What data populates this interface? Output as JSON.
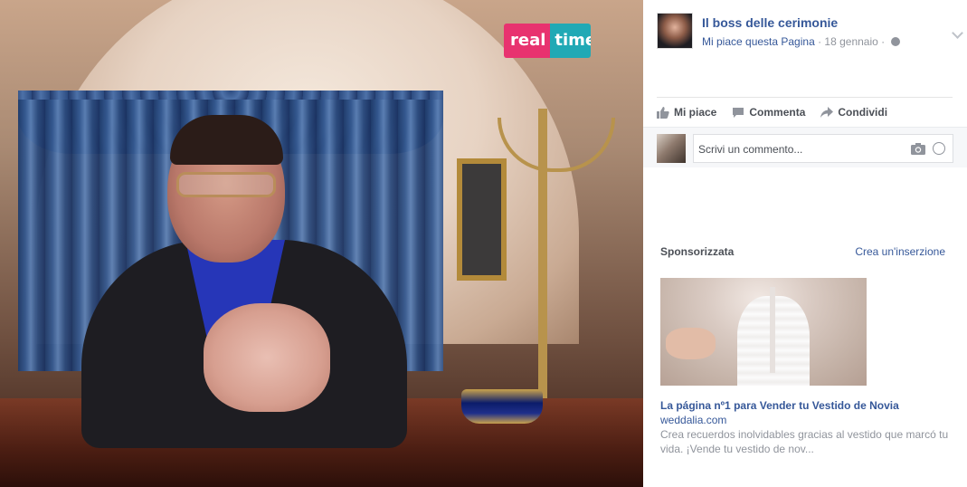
{
  "media": {
    "logo_text_1": "real",
    "logo_text_2": "time",
    "logo_colors": [
      "#e8326f",
      "#20a9b5"
    ]
  },
  "post": {
    "page_name": "Il boss delle cerimonie",
    "like_page": "Mi piace questa Pagina",
    "separator": " · ",
    "date": "18 gennaio",
    "privacy_icon": "globe-icon",
    "menu_icon": "chevron-down-icon"
  },
  "actions": [
    {
      "label": "Mi piace",
      "icon": "thumbs-up-icon"
    },
    {
      "label": "Commenta",
      "icon": "comment-icon"
    },
    {
      "label": "Condividi",
      "icon": "share-icon"
    }
  ],
  "comment": {
    "placeholder": "Scrivi un commento...",
    "icons": [
      "camera-icon",
      "smiley-icon"
    ]
  },
  "sponsored": {
    "title": "Sponsorizzata",
    "create_ad": "Crea un'inserzione",
    "ad": {
      "title": "La página nº1 para Vender tu Vestido de Novia",
      "domain": "weddalia.com",
      "body": "Crea recuerdos inolvidables gracias al vestido que marcó tu vida. ¡Vende tu vestido de nov..."
    }
  },
  "colors": {
    "link": "#365899",
    "muted": "#90949c",
    "action": "#4b4f56"
  }
}
